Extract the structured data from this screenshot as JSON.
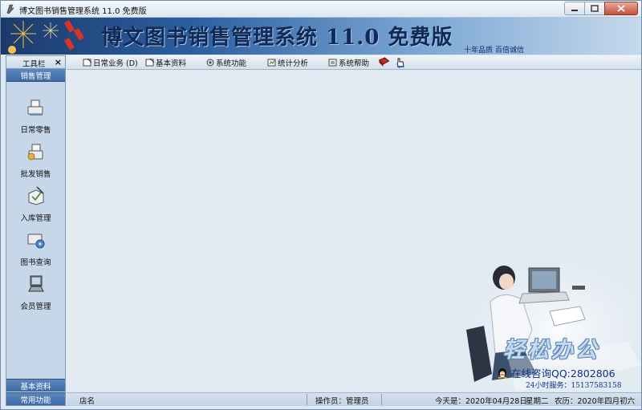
{
  "window": {
    "title": "博文图书销售管理系统 11.0 免费版"
  },
  "banner": {
    "title": "博文图书销售管理系统 11.0 免费版",
    "slogan": "十年品质  百倍诚信"
  },
  "sidebar": {
    "header": "工具栏",
    "close_glyph": "×",
    "group": "销售管理",
    "items": [
      {
        "label": "日常零售",
        "icon": "cash-register-icon"
      },
      {
        "label": "批发销售",
        "icon": "wholesale-icon"
      },
      {
        "label": "入库管理",
        "icon": "stock-in-icon"
      },
      {
        "label": "图书查询",
        "icon": "book-search-icon"
      },
      {
        "label": "会员管理",
        "icon": "member-icon"
      }
    ],
    "bottom_groups": [
      "基本资料",
      "常用功能"
    ]
  },
  "menu": {
    "items": [
      {
        "label": "日常业务 (D)",
        "icon": "daily-business-icon"
      },
      {
        "label": "基本资料",
        "icon": "basic-data-icon"
      },
      {
        "label": "系统功能",
        "icon": "system-function-icon"
      },
      {
        "label": "统计分析",
        "icon": "statistics-icon"
      },
      {
        "label": "系统帮助",
        "icon": "system-help-icon"
      }
    ],
    "extra_icons": [
      "book-icon",
      "hand-pointer-icon"
    ]
  },
  "main": {
    "brand_script": "轻松办公",
    "qq": "在线咨询QQ:2802806",
    "service": "24小时服务：15137583158"
  },
  "status": {
    "shop": "店名",
    "operator": "操作员：管理员",
    "today": "今天是：2020年04月28日",
    "weekday": "星期二",
    "lunar": "农历：2020年四月初六"
  },
  "colors": {
    "banner_dark": "#1c3a6b",
    "sidebar_group": "#3d6aa4",
    "accent_text": "#0b2f8c"
  }
}
